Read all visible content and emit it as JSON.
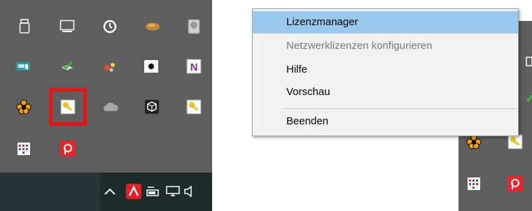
{
  "menu": {
    "items": [
      {
        "label": "Lizenzmanager",
        "state": "selected"
      },
      {
        "label": "Netzwerklizenzen konfigurieren",
        "state": "disabled"
      },
      {
        "label": "Hilfe",
        "state": "normal"
      },
      {
        "label": "Vorschau",
        "state": "normal"
      },
      {
        "label": "Beenden",
        "state": "normal"
      }
    ]
  },
  "tray_icons": [
    "usb-drive-icon",
    "display-icon",
    "clock-icon",
    "paint-brush-icon",
    "drive-icon",
    "keyboard-icon",
    "sync-check-icon",
    "network-bug-icon",
    "record-icon",
    "onenote-icon",
    "flower-icon",
    "license-key-icon",
    "cloud-icon",
    "cube-icon",
    "license-key-icon",
    "calendar-icon",
    "pdf-icon"
  ],
  "taskbar_icons": [
    "show-hidden-icons-chevron",
    "avira-icon",
    "battery-icon",
    "network-icon",
    "volume-icon"
  ],
  "colors": {
    "flyout_bg": "#5e5e5e",
    "taskbar_bg": "#1e2b2b",
    "menu_bg": "#f2f2f2",
    "menu_selected": "#99c9ef",
    "highlight_border": "#e81414"
  }
}
